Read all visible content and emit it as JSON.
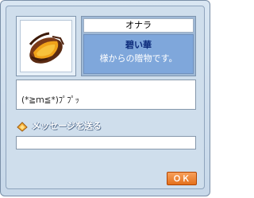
{
  "gift": {
    "item_icon": "roasted-sweet-potato-icon",
    "sender_name": "オナラ",
    "gift_title": "碧い華",
    "gift_description": "様からの贈物です。",
    "message": "(*≧ｍ≦*)ﾌﾟﾌﾟｯ"
  },
  "reply": {
    "send_message_label": "メッセージを送る",
    "send_icon": "diamond-arrow-icon",
    "input_value": ""
  },
  "buttons": {
    "ok_label": "ＯＫ"
  },
  "colors": {
    "window_bg": "#cfdeec",
    "gift_panel": "#7fa7db",
    "gift_title": "#0b2a7a",
    "ok_button": "#e4701c"
  }
}
